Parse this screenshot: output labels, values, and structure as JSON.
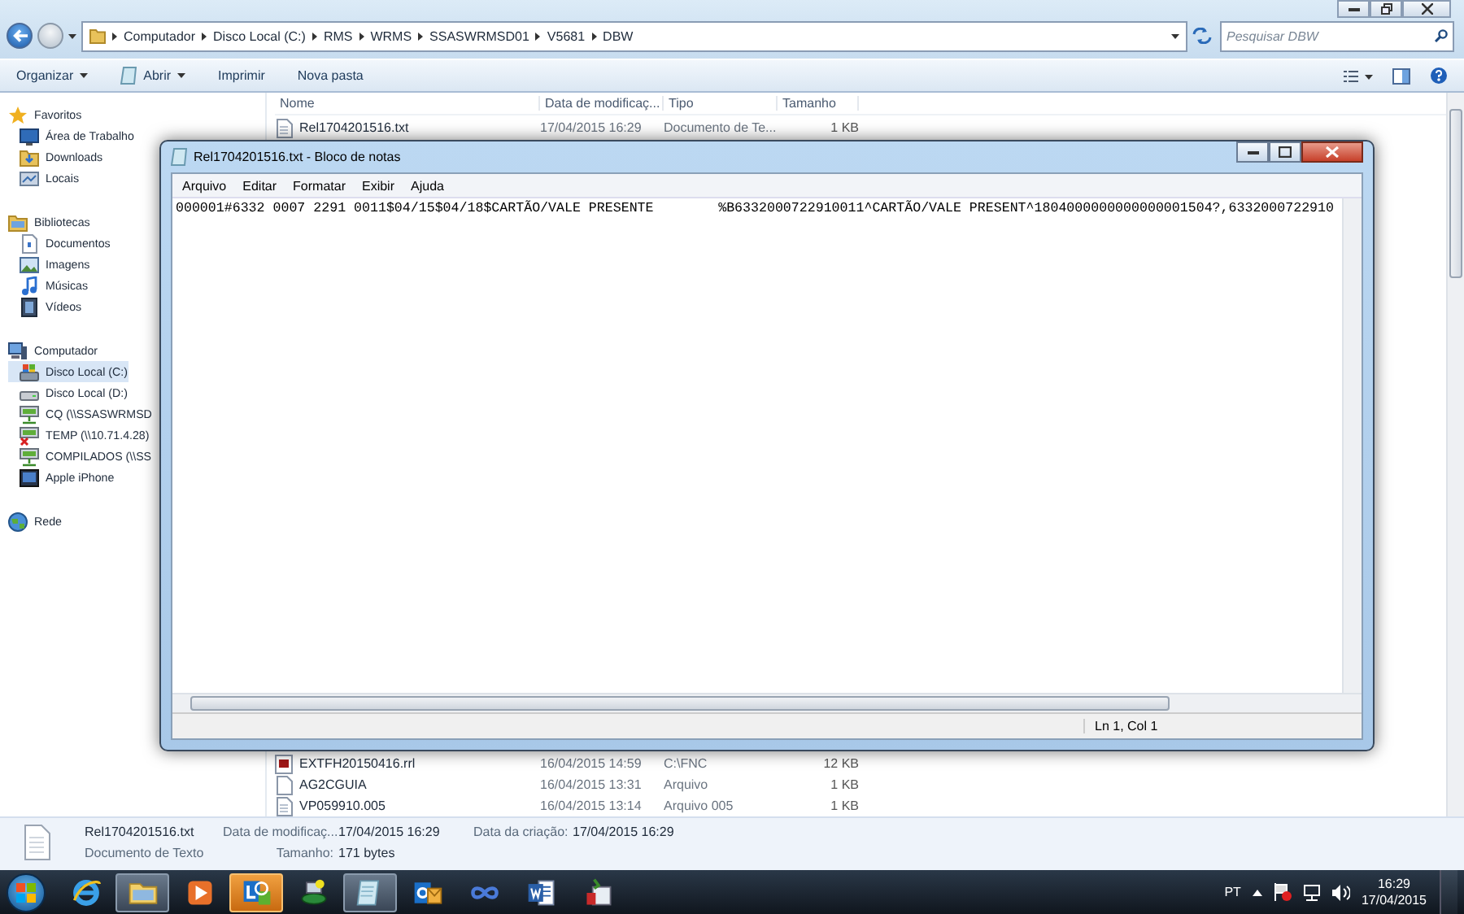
{
  "explorer": {
    "breadcrumb": [
      "Computador",
      "Disco Local (C:)",
      "RMS",
      "WRMS",
      "SSASWRMSD01",
      "V5681",
      "DBW"
    ],
    "search": {
      "placeholder": "Pesquisar DBW"
    },
    "toolbar": [
      {
        "label": "Organizar",
        "kind": "menu"
      },
      {
        "label": "Abrir",
        "kind": "open"
      },
      {
        "label": "Imprimir",
        "kind": "plain"
      },
      {
        "label": "Nova pasta",
        "kind": "plain"
      }
    ],
    "sidebar": [
      {
        "label": "Favoritos",
        "kind": "star",
        "selected": false,
        "children": [
          {
            "label": "Área de Trabalho",
            "kind": "desktop",
            "selected": false
          },
          {
            "label": "Downloads",
            "kind": "downloads",
            "selected": false
          },
          {
            "label": "Locais",
            "kind": "places",
            "selected": false
          }
        ]
      },
      {
        "label": "Bibliotecas",
        "kind": "library",
        "selected": false,
        "children": [
          {
            "label": "Documentos",
            "kind": "document",
            "selected": false
          },
          {
            "label": "Imagens",
            "kind": "image",
            "selected": false
          },
          {
            "label": "Músicas",
            "kind": "music",
            "selected": false
          },
          {
            "label": "Vídeos",
            "kind": "video",
            "selected": false
          }
        ]
      },
      {
        "label": "Computador",
        "kind": "computer",
        "selected": false,
        "children": [
          {
            "label": "Disco Local (C:)",
            "kind": "system-disk",
            "selected": true
          },
          {
            "label": "Disco Local (D:)",
            "kind": "disk",
            "selected": false
          },
          {
            "label": "CQ (\\\\SSASWRMSD",
            "kind": "net-drive",
            "selected": false
          },
          {
            "label": "TEMP (\\\\10.71.4.28)",
            "kind": "net-drive-error",
            "selected": false
          },
          {
            "label": "COMPILADOS (\\\\SS",
            "kind": "net-drive",
            "selected": false
          },
          {
            "label": "Apple iPhone",
            "kind": "phone",
            "selected": false
          }
        ]
      },
      {
        "label": "Rede",
        "kind": "network",
        "selected": false
      }
    ],
    "columns": [
      "Nome",
      "Data de modificaç...",
      "Tipo",
      "Tamanho"
    ],
    "rows": [
      {
        "name": "Rel1704201516.txt",
        "date": "17/04/2015 16:29",
        "type": "Documento de Te...",
        "size": "1 KB",
        "kind": "text"
      },
      {
        "name": "EXTFH20150416.rrl",
        "date": "16/04/2015 14:59",
        "type": "C:\\FNC",
        "size": "12 KB",
        "kind": "app-file"
      },
      {
        "name": "AG2CGUIA",
        "date": "16/04/2015 13:31",
        "type": "Arquivo",
        "size": "1 KB",
        "kind": "blank"
      },
      {
        "name": "VP059910.005",
        "date": "16/04/2015 13:14",
        "type": "Arquivo 005",
        "size": "1 KB",
        "kind": "text"
      }
    ],
    "details": {
      "name": "Rel1704201516.txt",
      "type": "Documento de Texto",
      "fields": [
        {
          "label": "Data de modificaç...",
          "value": "17/04/2015 16:29"
        },
        {
          "label": "Tamanho:",
          "value": "171 bytes"
        },
        {
          "label": "Data da criação:",
          "value": "17/04/2015 16:29"
        }
      ]
    }
  },
  "notepad": {
    "title": "Rel1704201516.txt - Bloco de notas",
    "menu": [
      "Arquivo",
      "Editar",
      "Formatar",
      "Exibir",
      "Ajuda"
    ],
    "content": "000001#6332 0007 2291 0011$04/15$04/18$CARTÃO/VALE PRESENTE        %B6332000722910011^CARTÃO/VALE PRESENT^1804000000000000001504?,6332000722910",
    "status": "Ln 1, Col 1"
  },
  "taskbar": {
    "apps": [
      {
        "kind": "browser",
        "active": false,
        "flashing": false
      },
      {
        "kind": "folder",
        "active": true,
        "flashing": false
      },
      {
        "kind": "media",
        "active": false,
        "flashing": false
      },
      {
        "kind": "chat",
        "active": false,
        "flashing": true
      },
      {
        "kind": "server",
        "active": false,
        "flashing": false
      },
      {
        "kind": "notepad",
        "active": true,
        "flashing": false
      },
      {
        "kind": "mail",
        "active": false,
        "flashing": false
      },
      {
        "kind": "infinity",
        "active": false,
        "flashing": false
      },
      {
        "kind": "word",
        "active": false,
        "flashing": false
      },
      {
        "kind": "tool",
        "active": false,
        "flashing": false
      }
    ],
    "language": "PT",
    "time": "16:29",
    "date": "17/04/2015"
  }
}
